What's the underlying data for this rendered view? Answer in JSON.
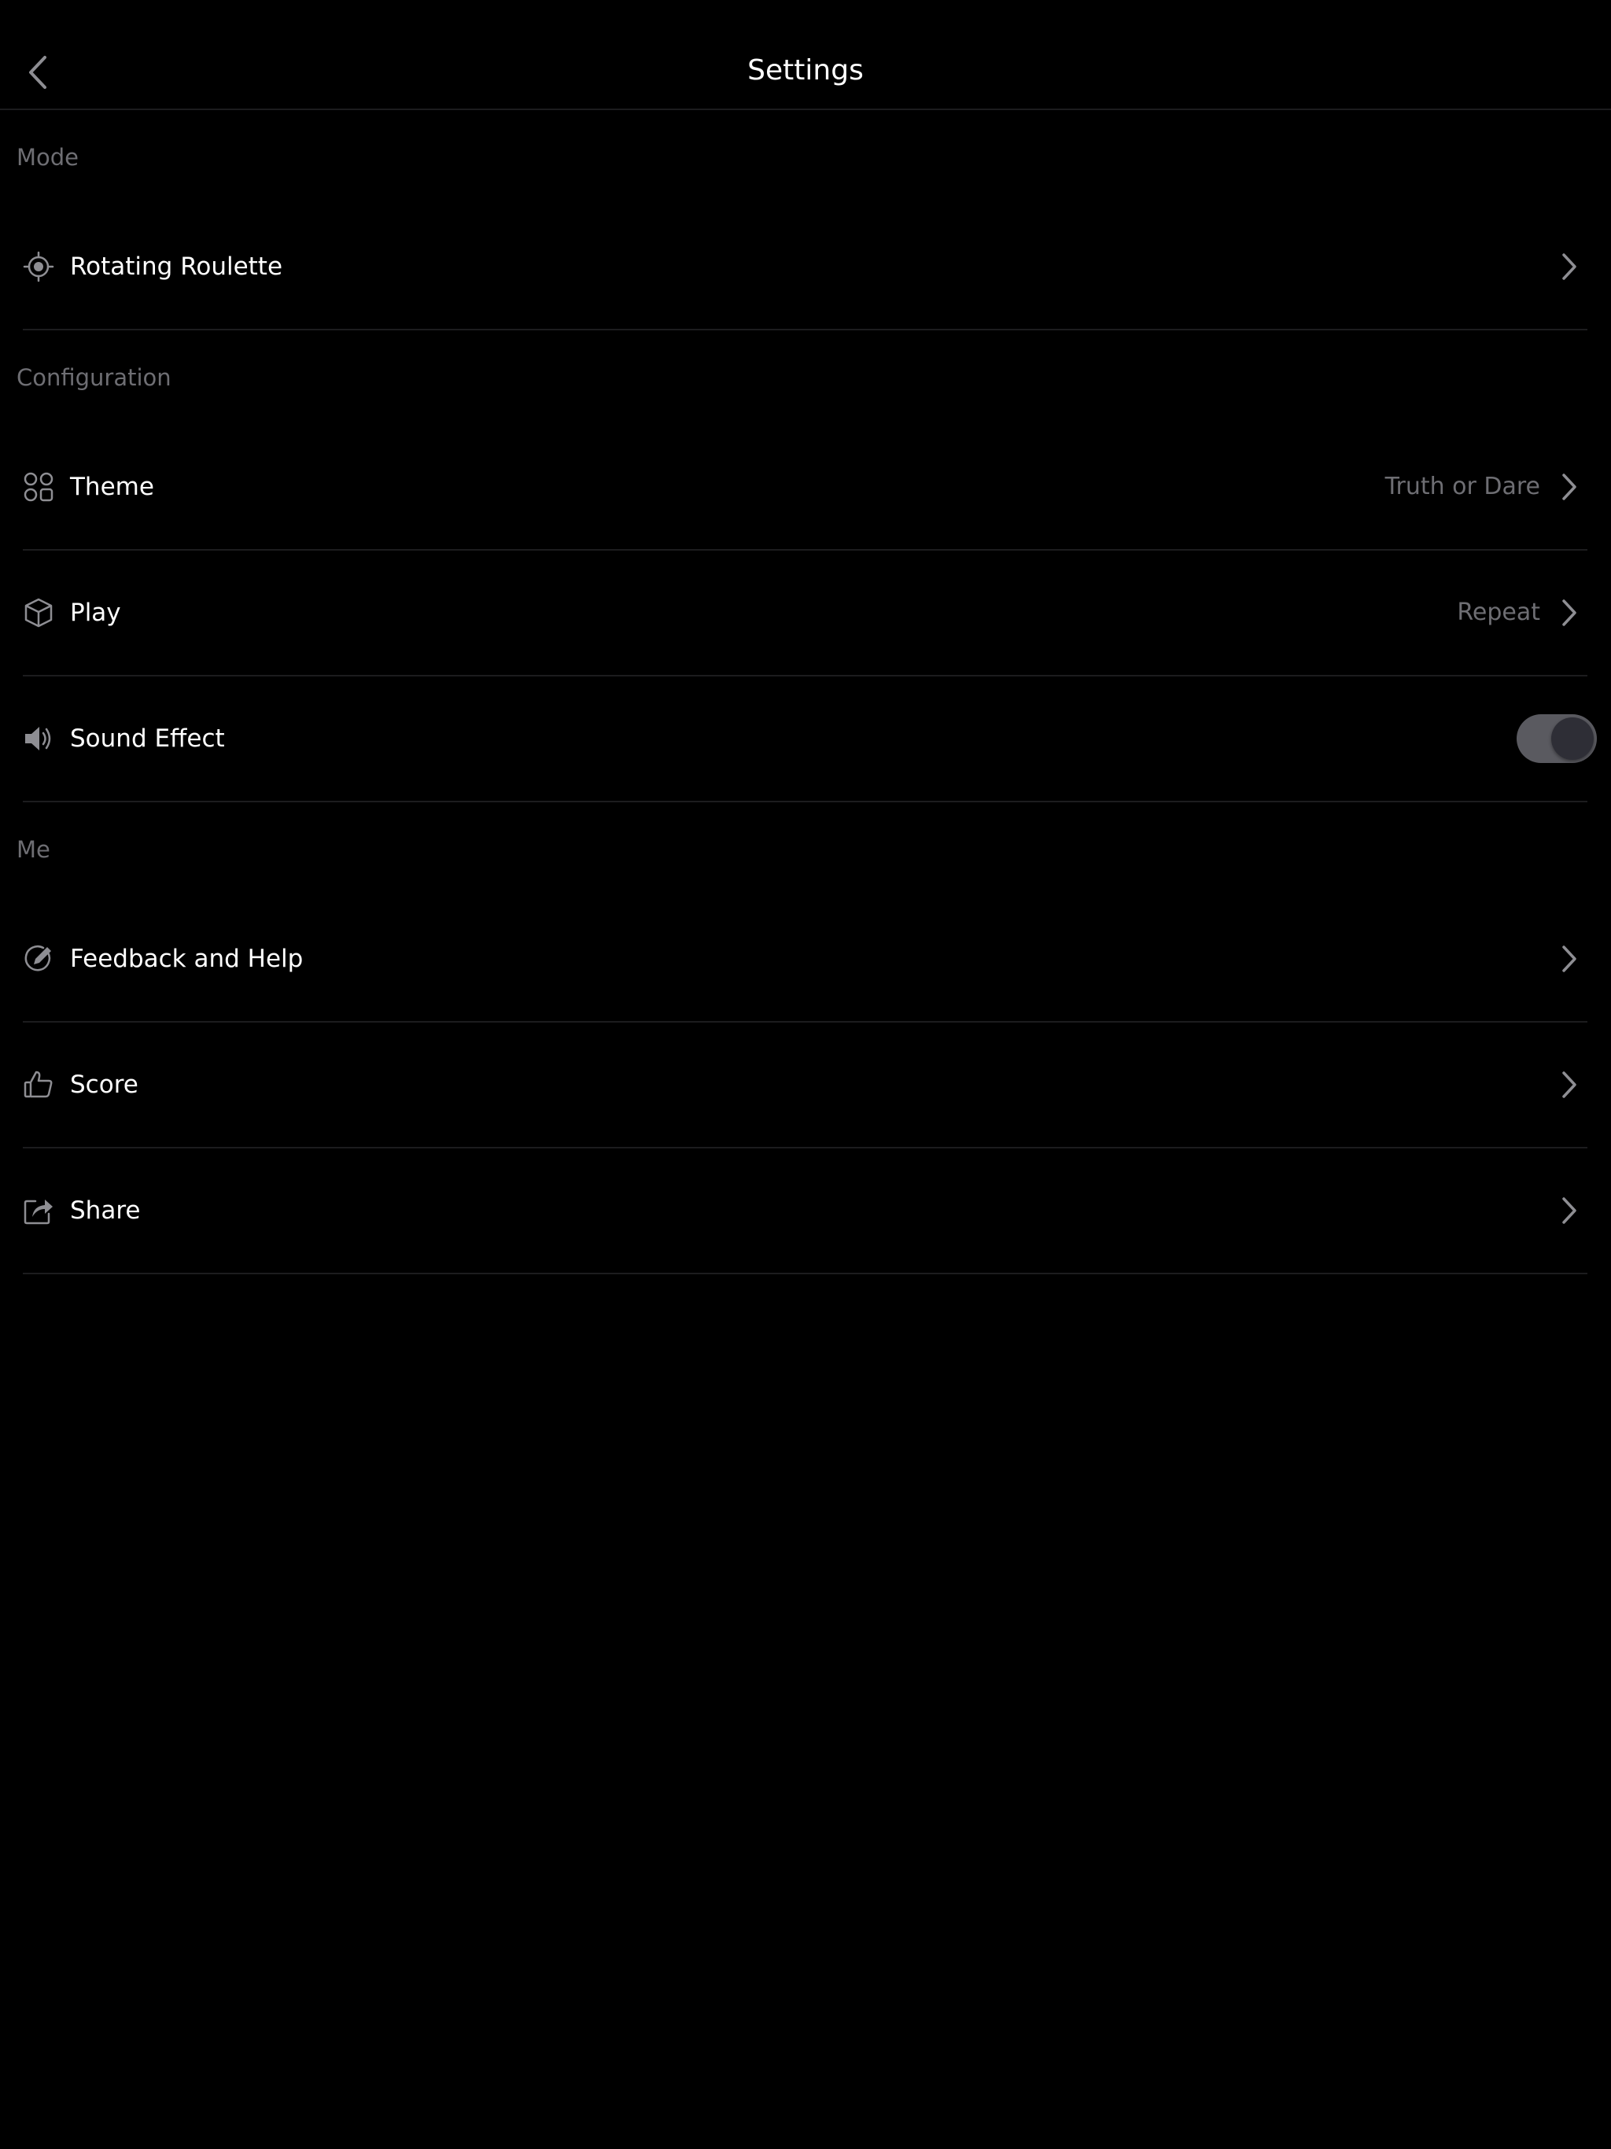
{
  "header": {
    "title": "Settings",
    "back_icon": "chevron-left-icon"
  },
  "sections": [
    {
      "title": "Mode",
      "items": [
        {
          "label": "Rotating Roulette",
          "icon": "target-icon",
          "value": "",
          "control": "chevron"
        }
      ]
    },
    {
      "title": "Configuration",
      "items": [
        {
          "label": "Theme",
          "icon": "grid-icon",
          "value": "Truth or Dare",
          "control": "chevron"
        },
        {
          "label": "Play",
          "icon": "cube-icon",
          "value": "Repeat",
          "control": "chevron"
        },
        {
          "label": "Sound Effect",
          "icon": "speaker-icon",
          "value": "",
          "control": "toggle",
          "toggle_on": false
        }
      ]
    },
    {
      "title": "Me",
      "items": [
        {
          "label": "Feedback and Help",
          "icon": "feedback-icon",
          "value": "",
          "control": "chevron"
        },
        {
          "label": "Score",
          "icon": "thumbs-up-icon",
          "value": "",
          "control": "chevron"
        },
        {
          "label": "Share",
          "icon": "share-icon",
          "value": "",
          "control": "chevron"
        }
      ]
    }
  ],
  "colors": {
    "background": "#000000",
    "text": "#ffffff",
    "secondary_text": "#6e6e73",
    "divider": "#1c1c1e",
    "icon": "#8e8e93",
    "toggle_track": "#5a5a60",
    "toggle_knob": "#2e2e36"
  }
}
